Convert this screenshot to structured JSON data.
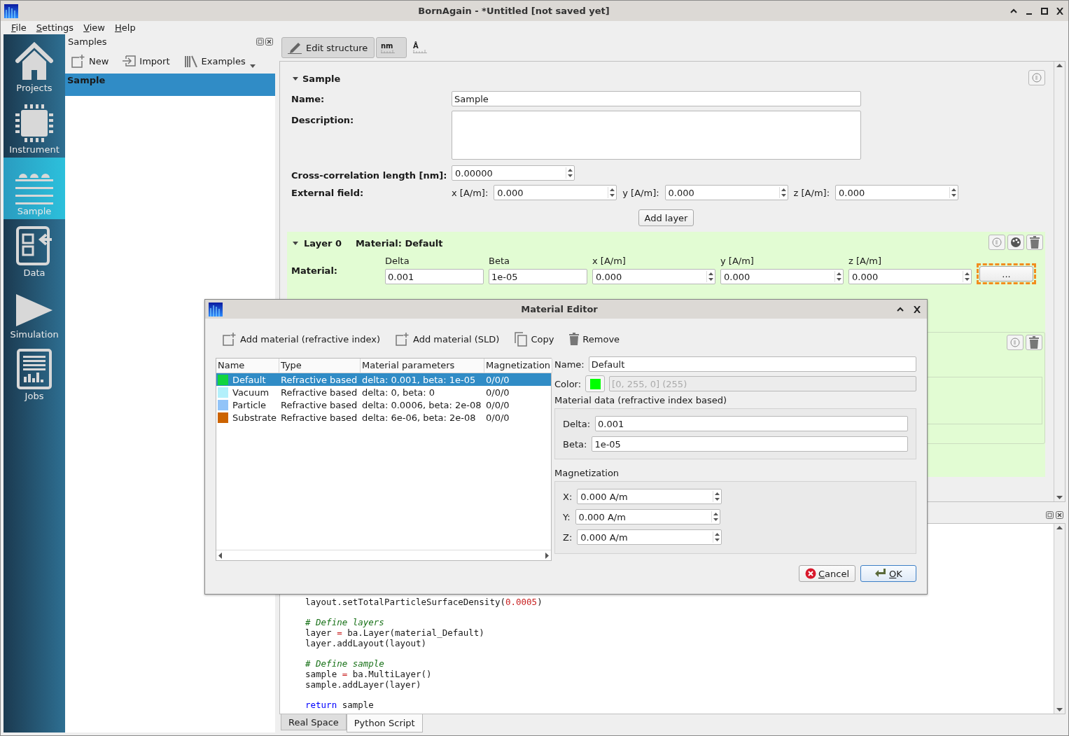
{
  "window": {
    "title": "BornAgain - *Untitled [not saved yet]"
  },
  "menu": [
    "File",
    "Settings",
    "View",
    "Help"
  ],
  "sidebar": {
    "items": [
      {
        "label": "Projects",
        "kind": "home",
        "selected": false
      },
      {
        "label": "Instrument",
        "kind": "chip",
        "selected": false
      },
      {
        "label": "Sample",
        "kind": "layers",
        "selected": true
      },
      {
        "label": "Data",
        "kind": "data",
        "selected": false
      },
      {
        "label": "Simulation",
        "kind": "play",
        "selected": false
      },
      {
        "label": "Jobs",
        "kind": "jobs",
        "selected": false
      }
    ]
  },
  "samples_dock": {
    "title": "Samples",
    "toolbar": [
      {
        "label": "New",
        "kind": "new"
      },
      {
        "label": "Import",
        "kind": "import"
      },
      {
        "label": "Examples",
        "kind": "examples"
      }
    ],
    "items": [
      {
        "label": "Sample",
        "selected": true
      }
    ]
  },
  "editor_toolbar": [
    {
      "label": "Edit structure",
      "kind": "edit",
      "selected": true
    },
    {
      "label": "nm",
      "kind": "unit",
      "selected": true
    },
    {
      "label": "Å",
      "kind": "unit",
      "selected": false
    }
  ],
  "sample": {
    "title": "Sample",
    "expanded": true,
    "name_label": "Name:",
    "name": "Sample",
    "description_label": "Description:",
    "cross_corr_label": "Cross-correlation length [nm]:",
    "cross_corr": "0.00000",
    "external_field_label": "External field:",
    "field": [
      {
        "label": "x [A/m]:",
        "value": "0.000"
      },
      {
        "label": "y [A/m]:",
        "value": "0.000"
      },
      {
        "label": "z [A/m]:",
        "value": "0.000"
      }
    ],
    "add_layer": "Add layer"
  },
  "layer": {
    "title": "Layer 0",
    "expanded": true,
    "material_title": "Material: Default",
    "material_label": "Material:",
    "columns": [
      {
        "label": "Delta",
        "value": "0.001",
        "kind": "text"
      },
      {
        "label": "Beta",
        "value": "1e-05",
        "kind": "text"
      },
      {
        "label": "x [A/m]",
        "value": "0.000",
        "kind": "spin"
      },
      {
        "label": "y [A/m]",
        "value": "0.000",
        "kind": "spin"
      },
      {
        "label": "z [A/m]",
        "value": "0.000",
        "kind": "spin"
      }
    ],
    "more_button": "..."
  },
  "code": {
    "blocks": [
      [
        [
          {
            "text": "layout.setTotalParticleSurfaceDensity(",
            "kind": "plain"
          },
          {
            "text": "0.0005",
            "kind": "number"
          },
          {
            "text": ")",
            "kind": "plain"
          }
        ]
      ],
      [
        [
          {
            "text": "# Define layers",
            "kind": "comment"
          }
        ],
        [
          {
            "text": "layer ",
            "kind": "plain"
          },
          {
            "text": "=",
            "kind": "operator"
          },
          {
            "text": " ba.Layer(material_Default)",
            "kind": "plain"
          }
        ],
        [
          {
            "text": "layer.addLayout(layout)",
            "kind": "plain"
          }
        ]
      ],
      [
        [
          {
            "text": "# Define sample",
            "kind": "comment"
          }
        ],
        [
          {
            "text": "sample ",
            "kind": "plain"
          },
          {
            "text": "=",
            "kind": "operator"
          },
          {
            "text": " ba.MultiLayer()",
            "kind": "plain"
          }
        ],
        [
          {
            "text": "sample.addLayer(layer)",
            "kind": "plain"
          }
        ]
      ],
      [
        [
          {
            "text": "return",
            "kind": "keyword"
          },
          {
            "text": " sample",
            "kind": "plain"
          }
        ]
      ]
    ]
  },
  "bottom_tabs": [
    {
      "label": "Real Space",
      "selected": false
    },
    {
      "label": "Python Script",
      "selected": true
    }
  ],
  "dialog": {
    "title": "Material Editor",
    "toolbar": [
      {
        "label": "Add material (refractive index)",
        "kind": "add"
      },
      {
        "label": "Add material (SLD)",
        "kind": "add"
      },
      {
        "label": "Copy",
        "kind": "copy"
      },
      {
        "label": "Remove",
        "kind": "remove"
      }
    ],
    "columns": [
      "Name",
      "Type",
      "Material parameters",
      "Magnetization"
    ],
    "rows": [
      {
        "name": "Default",
        "color": "#11d43f",
        "type": "Refractive based",
        "parameters": "delta: 0.001, beta: 1e-05",
        "magnetization": "0/0/0",
        "selected": true
      },
      {
        "name": "Vacuum",
        "color": "#b3f0fb",
        "type": "Refractive based",
        "parameters": "delta: 0, beta: 0",
        "magnetization": "0/0/0",
        "selected": false
      },
      {
        "name": "Particle",
        "color": "#92c4f8",
        "type": "Refractive based",
        "parameters": "delta: 0.0006, beta: 2e-08",
        "magnetization": "0/0/0",
        "selected": false
      },
      {
        "name": "Substrate",
        "color": "#cc6300",
        "type": "Refractive based",
        "parameters": "delta: 6e-06, beta: 2e-08",
        "magnetization": "0/0/0",
        "selected": false
      }
    ],
    "name_label": "Name:",
    "name": "Default",
    "color_label": "Color:",
    "color": "#00ff00",
    "color_text": "[0, 255, 0] (255)",
    "data_title": "Material data (refractive index based)",
    "data_fields": [
      {
        "label": "Delta:",
        "value": "0.001"
      },
      {
        "label": "Beta:",
        "value": "1e-05"
      }
    ],
    "magnetization_title": "Magnetization",
    "magnetization": [
      {
        "label": "X:",
        "value": "0.000 A/m"
      },
      {
        "label": "Y:",
        "value": "0.000 A/m"
      },
      {
        "label": "Z:",
        "value": "0.000 A/m"
      }
    ],
    "buttons": [
      {
        "label": "Cancel",
        "kind": "cancel",
        "default": false
      },
      {
        "label": "OK",
        "kind": "ok",
        "default": true
      }
    ]
  }
}
